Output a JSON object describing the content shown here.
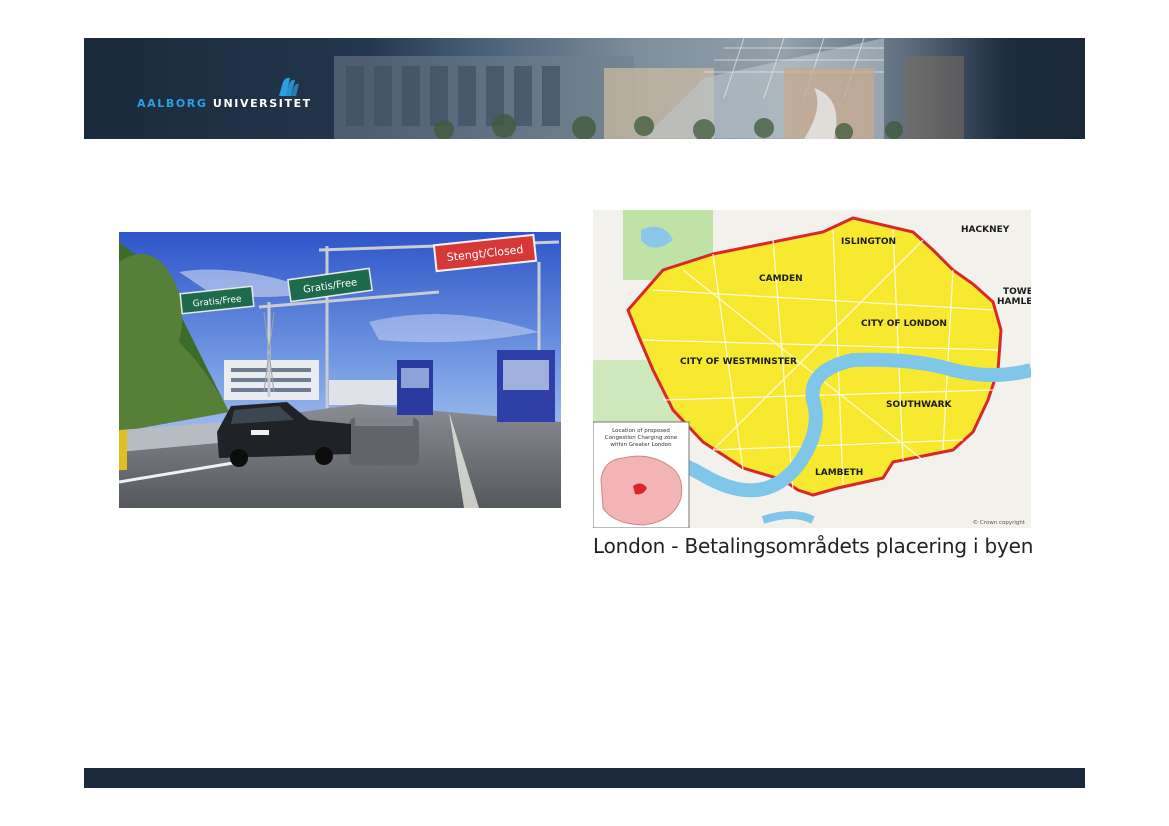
{
  "header": {
    "logo_word_1": "AALBORG",
    "logo_word_2": "UNIVERSITET"
  },
  "photo": {
    "sign_left": "Gratis/Free",
    "sign_middle": "Gratis/Free",
    "sign_right": "Stengt/Closed"
  },
  "map": {
    "labels": {
      "hackney": "HACKNEY",
      "islington": "ISLINGTON",
      "camden": "CAMDEN",
      "tower_1": "TOWE",
      "tower_2": "HAMLE",
      "city_of_london": "CITY OF LONDON",
      "city_of_westminster": "CITY OF WESTMINSTER",
      "southwark": "SOUTHWARK",
      "lambeth": "LAMBETH"
    },
    "inset_text": [
      "Location of proposed",
      "Congestion Charging zone",
      "within Greater London"
    ],
    "copyright": "© Crown copyright"
  },
  "caption": "London - Betalingsområdets placering i byen",
  "colors": {
    "header_dark": "#1b2a3c",
    "logo_blue": "#2aa0e0",
    "zone_yellow": "#f7e930",
    "zone_border": "#d8282a",
    "river": "#7fc6e8"
  }
}
